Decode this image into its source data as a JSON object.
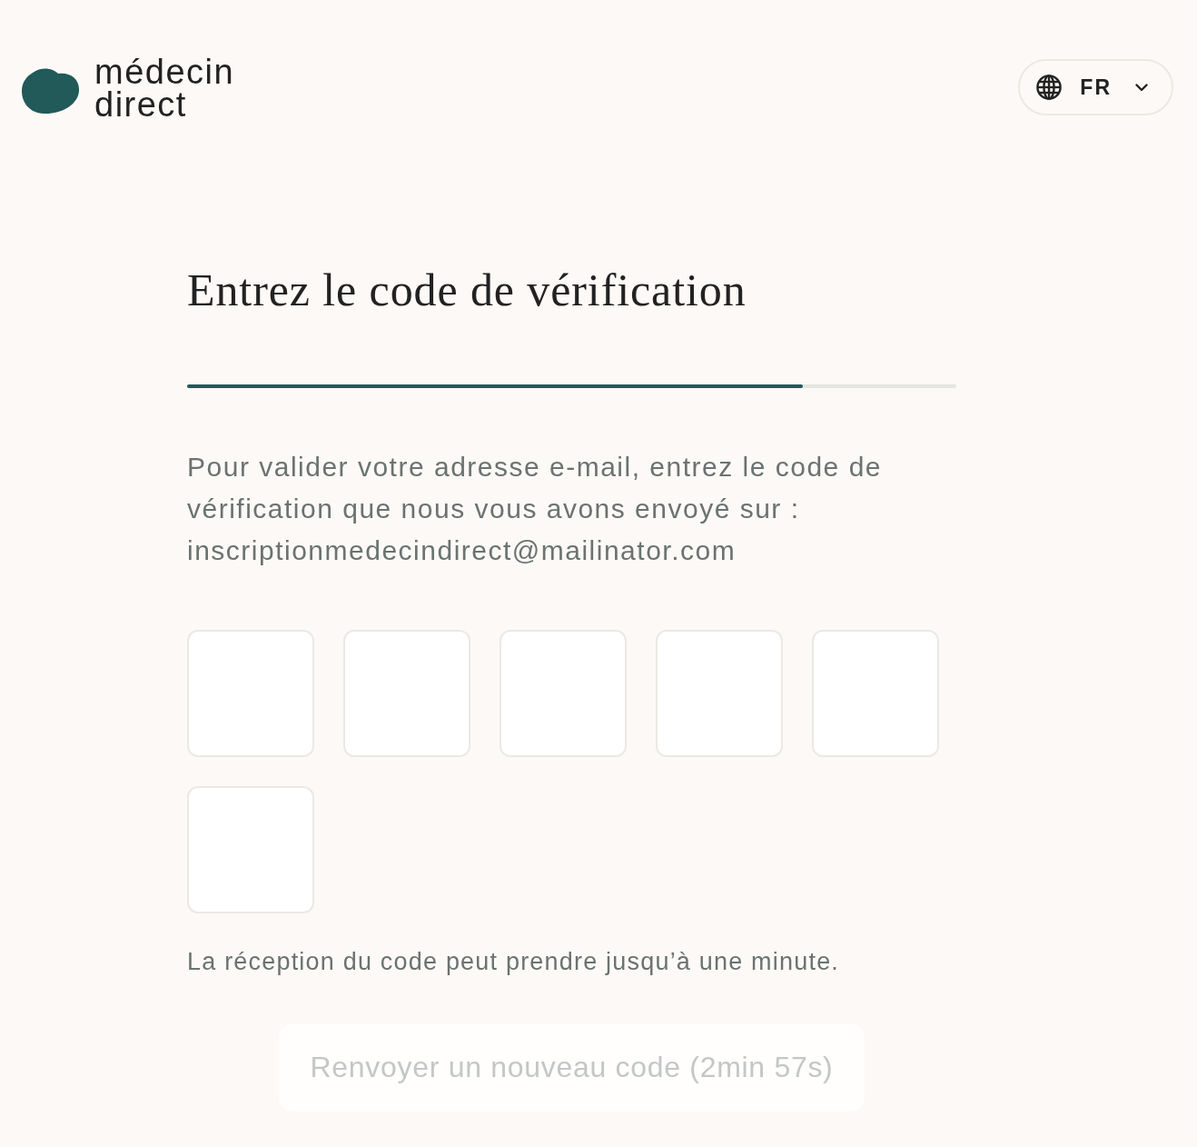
{
  "header": {
    "logo": {
      "lines": [
        "médecin",
        "direct"
      ]
    },
    "language_selector": {
      "label": "FR"
    }
  },
  "title": "Entrez le code de vérification",
  "progress": {
    "level": 0.8
  },
  "instructions": "Pour valider votre adresse e-mail, entrez le code de vérification que nous vous avons envoyé sur : inscriptionmedecindirect@mailinator.com",
  "code_inputs": [
    {
      "kind": "digit"
    },
    {
      "kind": "digit"
    },
    {
      "kind": "digit"
    },
    {
      "kind": "digit"
    },
    {
      "kind": "digit"
    },
    {
      "kind": "digit"
    }
  ],
  "hint": "La réception du code peut prendre jusqu’à une minute.",
  "resend_button": {
    "label": "Renvoyer un nouveau code (2min 57s)",
    "disabled": true
  }
}
